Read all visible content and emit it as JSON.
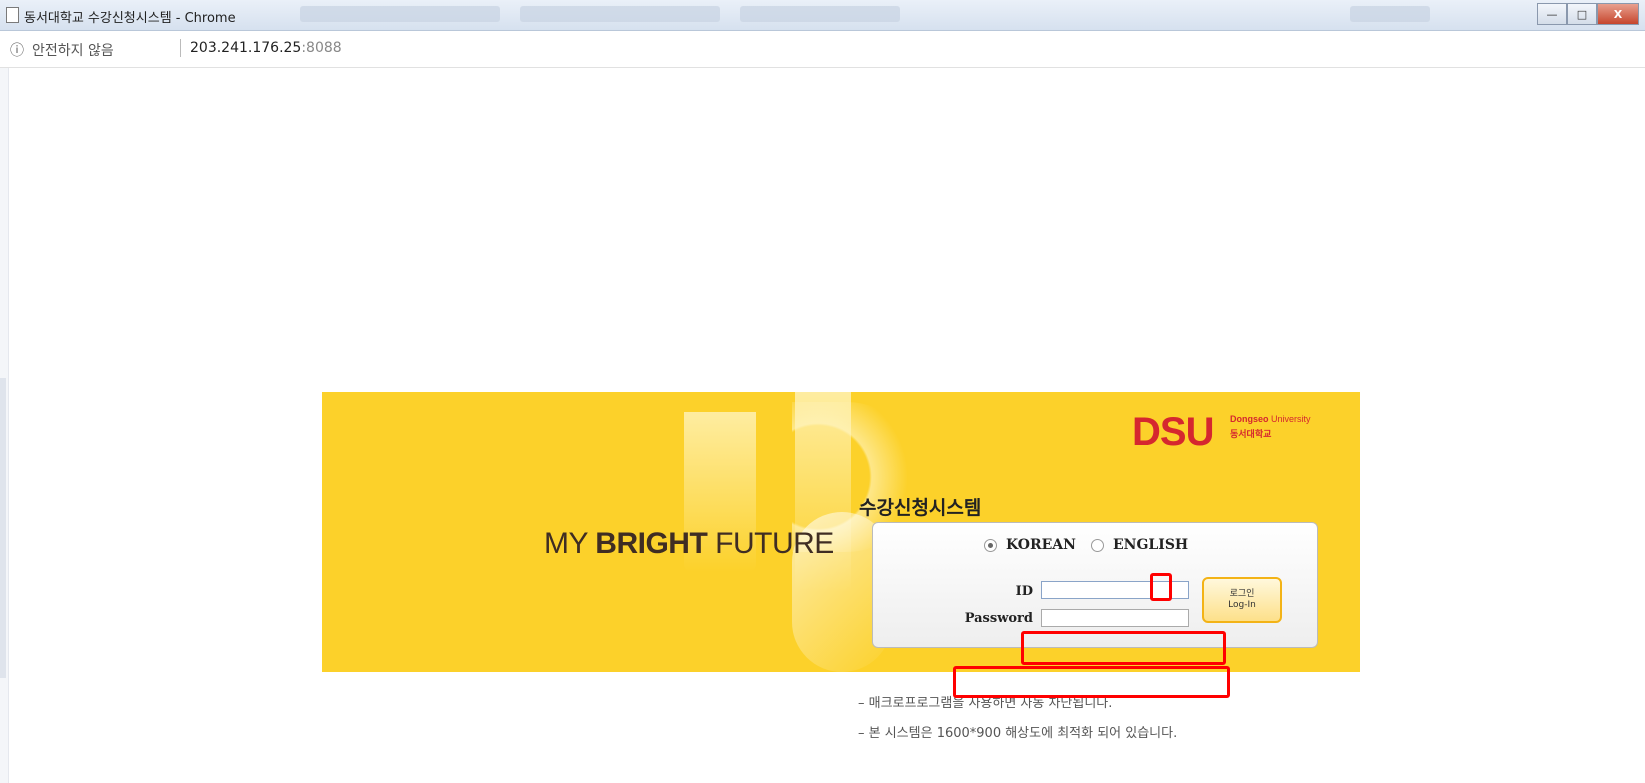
{
  "window": {
    "title": "동서대학교 수강신청시스템 - Chrome",
    "controls": {
      "minimize": "—",
      "maximize": "□",
      "close": "X"
    }
  },
  "addressbar": {
    "security_icon": "ⓘ",
    "security_text": "안전하지 않음",
    "host": "203.241.176.25",
    "port": ":8088"
  },
  "banner": {
    "slogan_prefix": "MY ",
    "slogan_bold": "BRIGHT",
    "slogan_suffix": " FUTURE",
    "logo": {
      "mark": "DSU",
      "name_en_bold": "Dongseo",
      "name_en": " University",
      "name_ko": "동서대학교"
    },
    "system_title": "수강신청시스템"
  },
  "login": {
    "languages": [
      {
        "label": "KOREAN",
        "selected": true
      },
      {
        "label": "ENGLISH",
        "selected": false
      }
    ],
    "id_label": "ID",
    "password_label": "Password",
    "id_value": "",
    "password_value": "",
    "button_ko": "로그인",
    "button_en": "Log-In"
  },
  "notes": [
    "– 매크로프로그램을 사용하면 자동 차단됩니다.",
    "– 본 시스템은 1600*900 해상도에 최적화 되어 있습니다."
  ],
  "colors": {
    "banner": "#fcd12a",
    "logo_red": "#d5272f",
    "highlight": "#ff0000",
    "button_border": "#f3b316"
  }
}
